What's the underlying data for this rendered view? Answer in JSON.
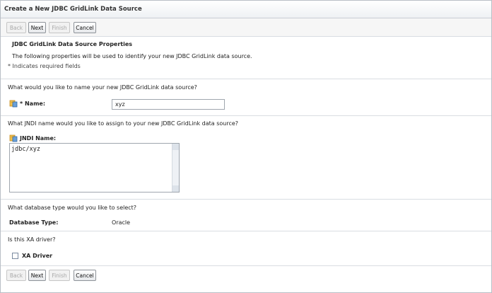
{
  "window": {
    "title": "Create a New JDBC GridLink Data Source"
  },
  "toolbar": {
    "back": "Back",
    "next": "Next",
    "finish": "Finish",
    "cancel": "Cancel"
  },
  "section": {
    "title": "JDBC GridLink Data Source Properties",
    "description": "The following properties will be used to identify your new JDBC GridLink data source.",
    "required_note": "* Indicates required fields"
  },
  "name_block": {
    "question": "What would you like to name your new JDBC GridLink data source?",
    "label": "* Name:",
    "value": "xyz"
  },
  "jndi_block": {
    "question": "What JNDI name would you like to assign to your new JDBC GridLink data source?",
    "label": "JNDI Name:",
    "value": "jdbc/xyz"
  },
  "db_block": {
    "question": "What database type would you like to select?",
    "label": "Database Type:",
    "value": "Oracle"
  },
  "xa_block": {
    "question": "Is this XA driver?",
    "label": "XA Driver",
    "checked": false
  }
}
